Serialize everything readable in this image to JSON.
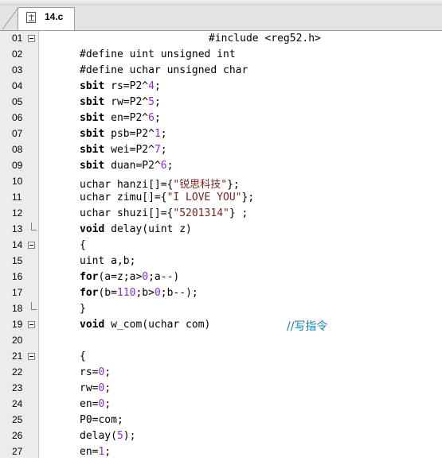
{
  "tab": {
    "filename": "14.c"
  },
  "lines": [
    {
      "no": "01",
      "text": "#include <reg52.h>"
    },
    {
      "no": "02",
      "text": "#define uint unsigned int"
    },
    {
      "no": "03",
      "text": "#define uchar unsigned char"
    },
    {
      "no": "04",
      "kw": "sbit",
      "rest": " rs=P2^",
      "num": "4",
      "end": ";"
    },
    {
      "no": "05",
      "kw": "sbit",
      "rest": " rw=P2^",
      "num": "5",
      "end": ";"
    },
    {
      "no": "06",
      "kw": "sbit",
      "rest": " en=P2^",
      "num": "6",
      "end": ";"
    },
    {
      "no": "07",
      "kw": "sbit",
      "rest": " psb=P2^",
      "num": "1",
      "end": ";"
    },
    {
      "no": "08",
      "kw": "sbit",
      "rest": " wei=P2^",
      "num": "7",
      "end": ";"
    },
    {
      "no": "09",
      "kw": "sbit",
      "rest": " duan=P2^",
      "num": "6",
      "end": ";"
    },
    {
      "no": "10",
      "pre": "uchar hanzi[]={",
      "str": "\"锐思科技\"",
      "end": "};"
    },
    {
      "no": "11",
      "pre": "uchar zimu[]={",
      "str": "\"I LOVE YOU\"",
      "end": "};"
    },
    {
      "no": "12",
      "pre": "uchar shuzi[]={",
      "str": "\"5201314\"",
      "end": "} ;"
    },
    {
      "no": "13",
      "kw": "void",
      "rest": " delay(uint z)"
    },
    {
      "no": "14",
      "text": "{"
    },
    {
      "no": "15",
      "text": "uint a,b;"
    },
    {
      "no": "16",
      "kw": "for",
      "a": "(a=z;a>",
      "n1": "0",
      "b": ";a--)"
    },
    {
      "no": "17",
      "kw": "for",
      "a": "(b=",
      "n1": "110",
      "b": ";b>",
      "n2": "0",
      "c": ";b--);"
    },
    {
      "no": "18",
      "text": "}"
    },
    {
      "no": "19",
      "kw": "void",
      "rest": " w_com(uchar com)",
      "comment": "//写指令"
    },
    {
      "no": "20",
      "text": ""
    },
    {
      "no": "21",
      "text": "{"
    },
    {
      "no": "22",
      "pre": "rs=",
      "num": "0",
      "end": ";"
    },
    {
      "no": "23",
      "pre": "rw=",
      "num": "0",
      "end": ";"
    },
    {
      "no": "24",
      "pre": "en=",
      "num": "0",
      "end": ";"
    },
    {
      "no": "25",
      "text": "P0=com;"
    },
    {
      "no": "26",
      "pre": "delay(",
      "num": "5",
      "end": ");"
    },
    {
      "no": "27",
      "pre": "en=",
      "num": "1",
      "end": ";"
    }
  ],
  "colors": {
    "keyword": "#000000",
    "number": "#8a2be2",
    "string": "#7a1f1f",
    "comment": "#1a7fa0"
  },
  "icons": {
    "tab": "c-file-icon",
    "fold_open": "fold-minus-icon",
    "fold_end": "fold-end-icon"
  }
}
